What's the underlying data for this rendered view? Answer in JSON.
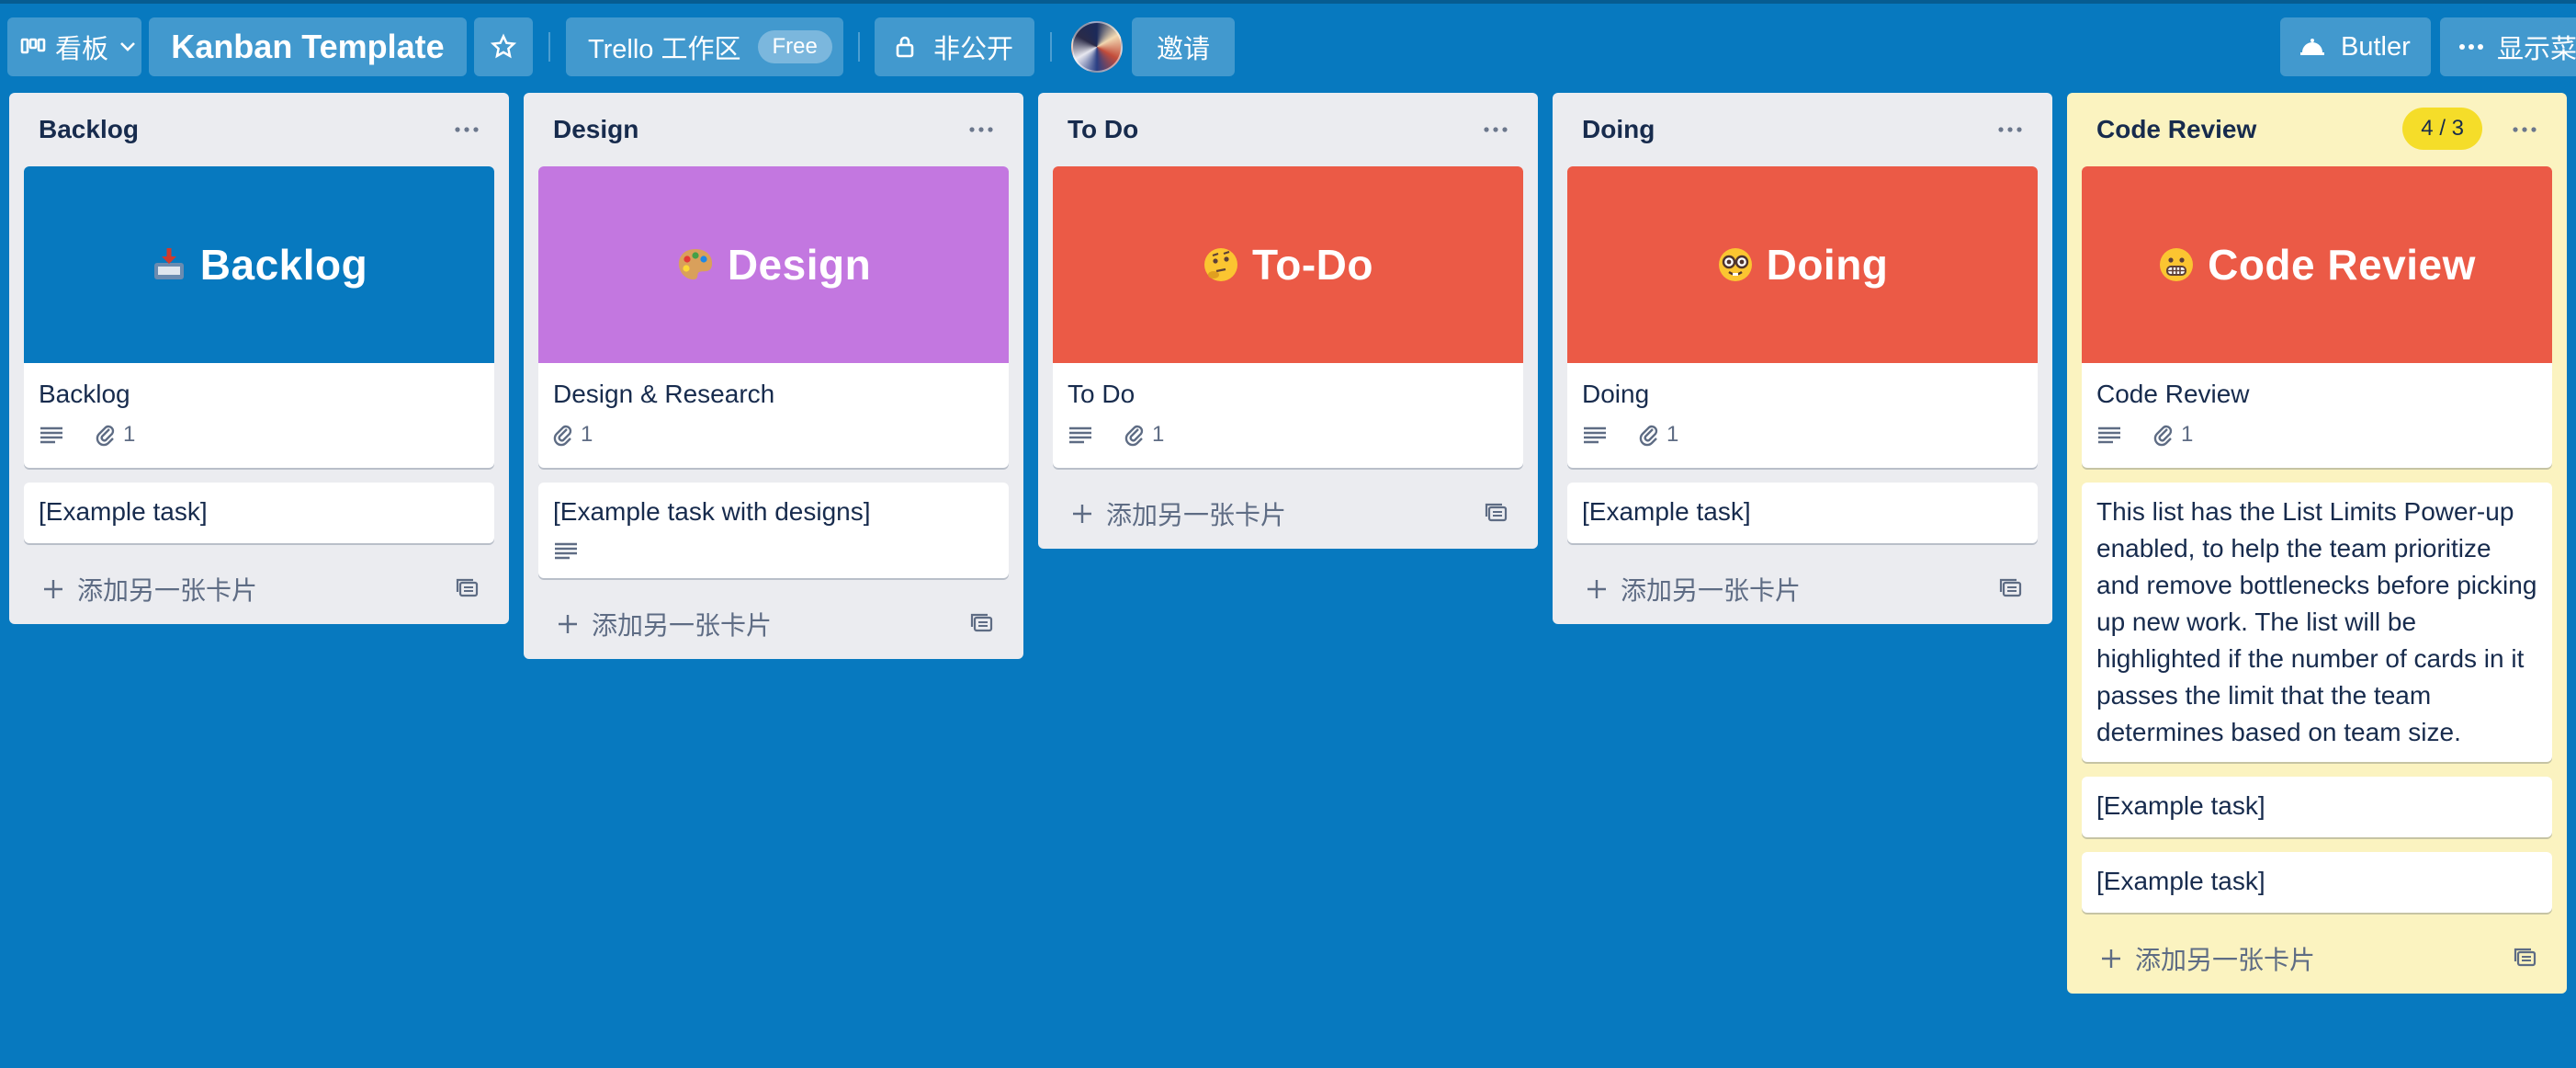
{
  "topbar": {
    "view_label": "看板",
    "board_title": "Kanban Template",
    "workspace_label": "Trello 工作区",
    "plan_badge": "Free",
    "visibility_label": "非公开",
    "invite_label": "邀请",
    "butler_label": "Butler",
    "menu_label": "显示菜"
  },
  "lists": [
    {
      "title": "Backlog",
      "cover": {
        "emoji": "📥",
        "text": "Backlog",
        "color": "#0779bf"
      },
      "card_title": "Backlog",
      "attachments": "1",
      "extra_cards": [
        "[Example task]"
      ],
      "add_label": "添加另一张卡片"
    },
    {
      "title": "Design",
      "cover": {
        "emoji": "🎨",
        "text": "Design",
        "color": "#c377e0"
      },
      "card_title": "Design & Research",
      "attachments": "1",
      "extra_cards": [
        "[Example task with designs]"
      ],
      "add_label": "添加另一张卡片"
    },
    {
      "title": "To Do",
      "cover": {
        "emoji": "🤔",
        "text": "To-Do",
        "color": "#eb5a46"
      },
      "card_title": "To Do",
      "attachments": "1",
      "extra_cards": [],
      "add_label": "添加另一张卡片"
    },
    {
      "title": "Doing",
      "cover": {
        "emoji": "🤓",
        "text": "Doing",
        "color": "#eb5a46"
      },
      "card_title": "Doing",
      "attachments": "1",
      "extra_cards": [
        "[Example task]"
      ],
      "add_label": "添加另一张卡片"
    },
    {
      "title": "Code Review",
      "limit_badge": "4 / 3",
      "cover": {
        "emoji": "😬",
        "text": "Code Review",
        "color": "#eb5a46"
      },
      "card_title": "Code Review",
      "attachments": "1",
      "info_card": "This list has the List Limits Power-up enabled, to help the team prioritize and remove bottlenecks before picking up new work. The list will be highlighted if the number of cards in it passes the limit that the team determines based on team size.",
      "extra_cards": [
        "[Example task]",
        "[Example task]"
      ],
      "add_label": "添加另一张卡片"
    }
  ],
  "colors": {
    "board_background": "#0779bf",
    "list_background": "#ebecf0",
    "limit_list_background": "#fbf3c0",
    "limit_badge": "#f5dd29"
  }
}
